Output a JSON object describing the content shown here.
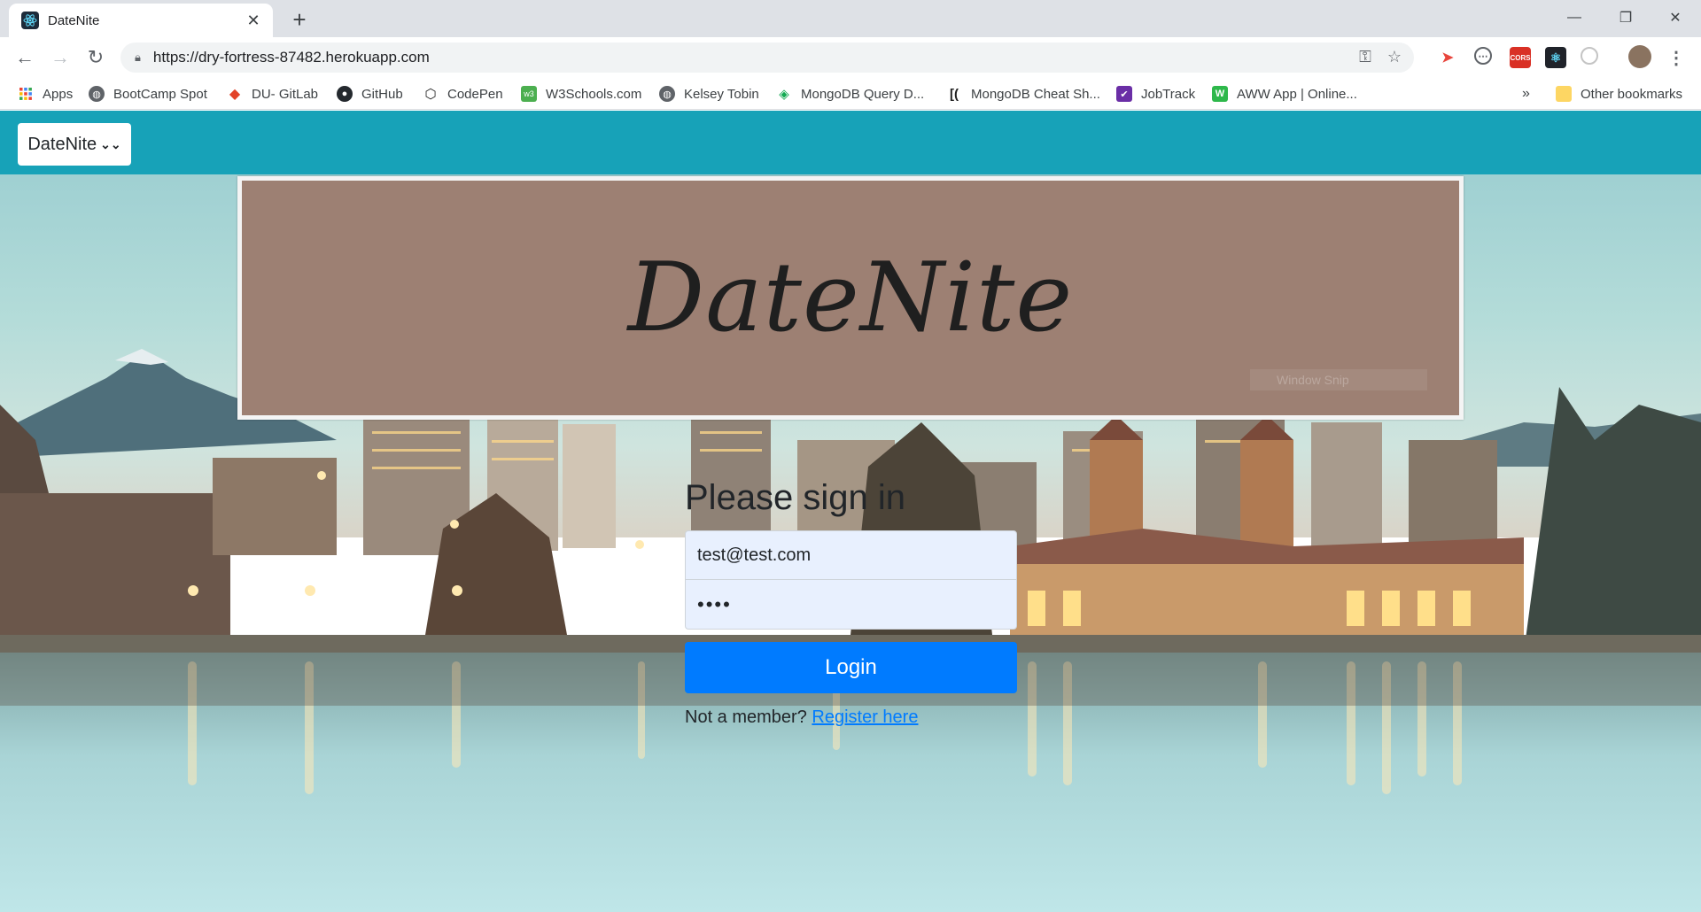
{
  "browser": {
    "tab_title": "DateNite",
    "url": "https://dry-fortress-87482.herokuapp.com",
    "bookmarks": [
      {
        "label": "Apps",
        "icon": "apps-grid-icon"
      },
      {
        "label": "BootCamp Spot",
        "icon": "globe-icon"
      },
      {
        "label": "DU- GitLab",
        "icon": "gitlab-icon"
      },
      {
        "label": "GitHub",
        "icon": "github-icon"
      },
      {
        "label": "CodePen",
        "icon": "codepen-icon"
      },
      {
        "label": "W3Schools.com",
        "icon": "w3schools-icon"
      },
      {
        "label": "Kelsey Tobin",
        "icon": "globe-icon"
      },
      {
        "label": "MongoDB Query D...",
        "icon": "mongodb-icon"
      },
      {
        "label": "MongoDB Cheat Sh...",
        "icon": "bracket-icon"
      },
      {
        "label": "JobTrack",
        "icon": "jobtrack-icon"
      },
      {
        "label": "AWW App | Online...",
        "icon": "aww-icon"
      }
    ],
    "overflow_label": "»",
    "other_bookmarks": "Other bookmarks"
  },
  "app": {
    "brand": "DateNite",
    "hero_title": "DateNite",
    "watermark": "Window Snip"
  },
  "signin": {
    "heading": "Please sign in",
    "email": "test@test.com",
    "password_mask": "••••",
    "login_label": "Login",
    "member_text": "Not a member?",
    "register_link": "Register here"
  },
  "colors": {
    "navbar": "#17a2b8",
    "primary": "#007bff",
    "hero_bg": "#9d8073"
  }
}
